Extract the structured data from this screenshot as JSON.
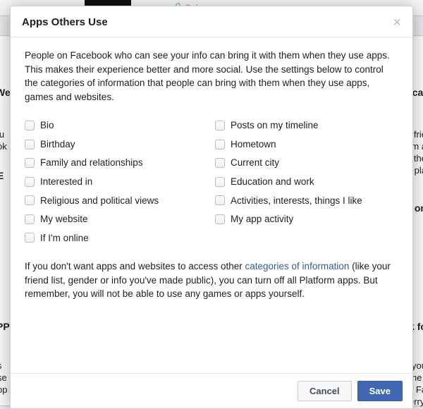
{
  "backdrop": {
    "only_me": "Only me",
    "bits": {
      "we": "We",
      "ificat": "ificat",
      "lu": "lu",
      "ok": "ok",
      "e": "E",
      "om_fri": "om frie",
      "rom_a": "rom a",
      "g_the": "g the",
      "or_pl": "or pla",
      "ed_on": "ed on",
      "pp": "PP",
      "ok_fo": "ok fo",
      "s": "s",
      "se": "se",
      "op": "op",
      "gs_you": "gs you",
      "e_the": "e the i",
      "of_fa": "of Fa",
      "bb": "BlackBerry."
    }
  },
  "modal": {
    "title": "Apps Others Use",
    "intro": "People on Facebook who can see your info can bring it with them when they use apps. This makes their experience better and more social. Use the settings below to control the categories of information that people can bring with them when they use apps, games and websites.",
    "columns": {
      "left": [
        "Bio",
        "Birthday",
        "Family and relationships",
        "Interested in",
        "Religious and political views",
        "My website",
        "If I'm online"
      ],
      "right": [
        "Posts on my timeline",
        "Hometown",
        "Current city",
        "Education and work",
        "Activities, interests, things I like",
        "My app activity"
      ]
    },
    "outro_pre": "If you don't want apps and websites to access other ",
    "outro_link": "categories of information",
    "outro_post": " (like your friend list, gender or info you've made public), you can turn off all Platform apps. But remember, you will not be able to use any games or apps yourself.",
    "cancel": "Cancel",
    "save": "Save"
  }
}
